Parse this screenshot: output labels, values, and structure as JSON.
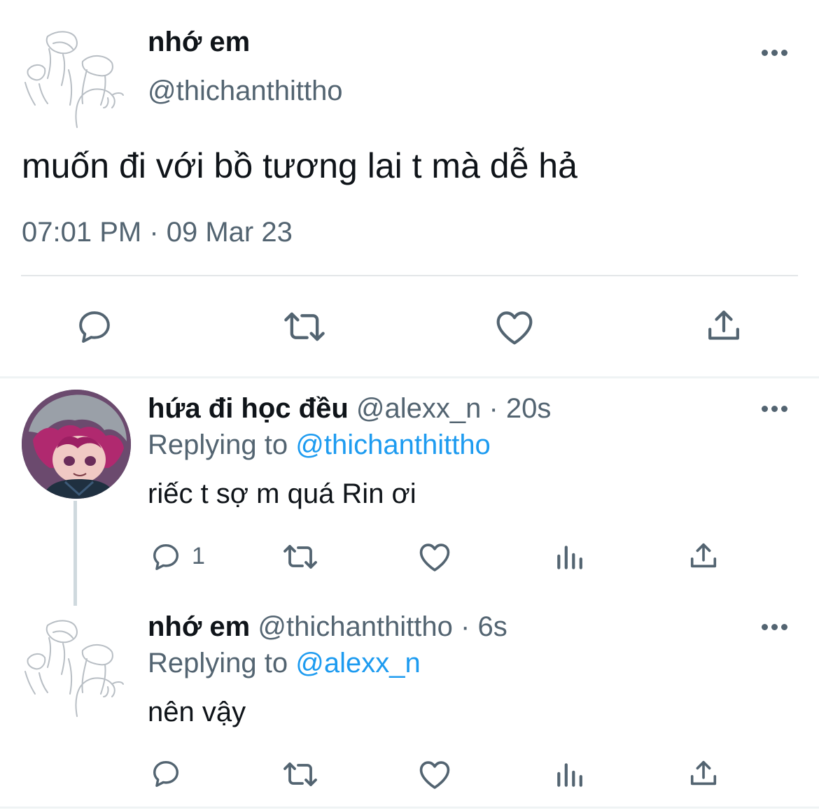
{
  "main_tweet": {
    "display_name": "nhớ em",
    "handle": "@thichanthittho",
    "text": "muốn đi với bồ tương lai t mà dễ hả",
    "timestamp": "07:01 PM · 09 Mar 23"
  },
  "replies": [
    {
      "display_name": "hứa đi học đều",
      "handle": "@alexx_n",
      "time": "· 20s",
      "replying_prefix": "Replying to",
      "replying_to": "@thichanthittho",
      "text": "riếc t sợ m quá Rin ơi",
      "reply_count": "1"
    },
    {
      "display_name": "nhớ em",
      "handle": "@thichanthittho",
      "time": "· 6s",
      "replying_prefix": "Replying to",
      "replying_to": "@alexx_n",
      "text": "nên vậy",
      "reply_count": ""
    }
  ],
  "colors": {
    "text": "#0f1419",
    "secondary": "#536471",
    "link": "#1d9bf0",
    "divider": "#e3e6e8"
  },
  "icons": [
    "more-icon",
    "reply-icon",
    "retweet-icon",
    "like-icon",
    "share-icon",
    "views-icon"
  ]
}
